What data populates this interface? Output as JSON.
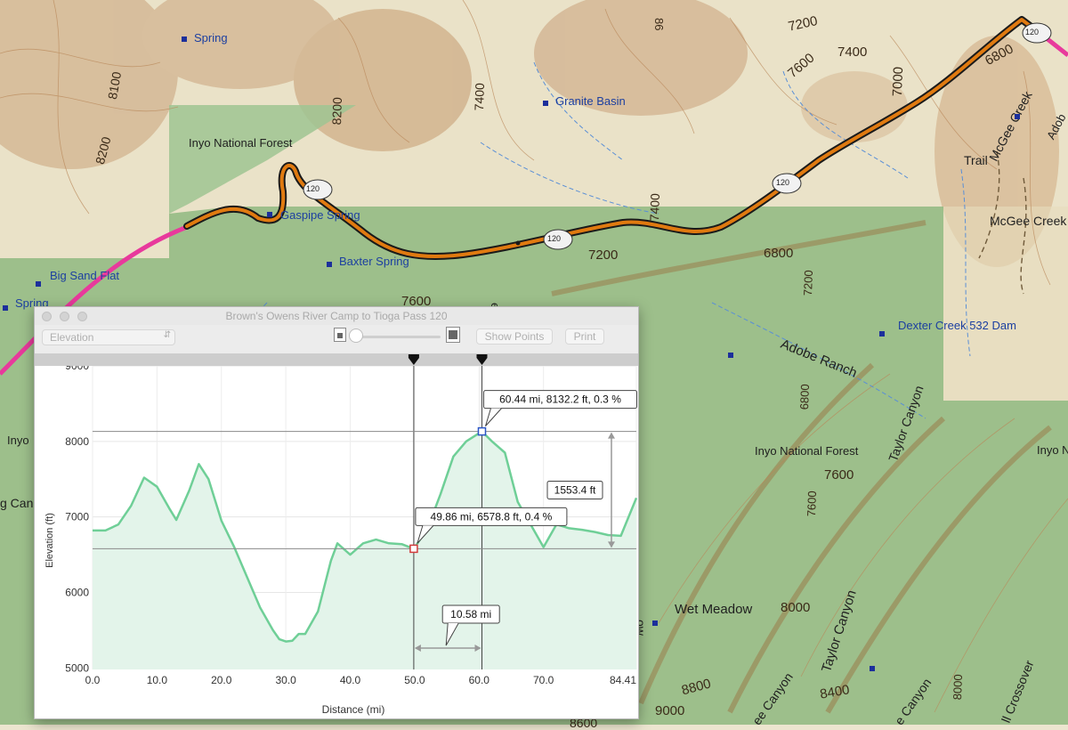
{
  "map": {
    "labels": {
      "spring_top": "Spring",
      "granite_basin": "Granite Basin",
      "inyo_nf_top": "Inyo National Forest",
      "gaspipe_spring": "Gaspipe Spring",
      "baxter_spring": "Baxter Spring",
      "big_sand_flat": "Big Sand Flat",
      "spring_left": "Spring",
      "trail": "Trail",
      "mcgee_creek_diag": "McGee Creek",
      "mcgee_creek": "McGee Creek",
      "adobe_right": "Adob",
      "dexter_creek_dam": "Dexter Creek 532 Dam",
      "adobe_ranch": "Adobe Ranch",
      "taylor_canyon": "Taylor Canyon",
      "inyo_nf_bottom": "Inyo National Forest",
      "inyo_right": "Inyo N",
      "inyo_left": "Inyo",
      "wet_meadow": "Wet Meadow",
      "taylor_canyon_2": "Taylor Canyon",
      "canyon_1": "ee Canyon",
      "canyon_2": "e Canyon",
      "crossover": "ll Crossover",
      "g_can": "g Can",
      "route_120_a": "120",
      "route_120_b": "120",
      "route_120_c": "120",
      "route_120_d": "120",
      "ers": "ers",
      "ow": "ow"
    },
    "elev": {
      "e8100": "8100",
      "e8200_left": "8200",
      "e8200": "8200",
      "e7400_top": "7400",
      "e7200_top": "7200",
      "e7600_top": "7600",
      "e7400_r": "7400",
      "e7000": "7000",
      "e6800_top": "6800",
      "e86": "86",
      "e7400_mid": "7400",
      "e7200_mid": "7200",
      "e6800_mid": "6800",
      "e7200_v": "7200",
      "e7600_left": "7600",
      "e6800_v": "6800",
      "e7600_r": "7600",
      "e7600_v": "7600",
      "e8000": "8000",
      "e8800": "8800",
      "e8400": "8400",
      "e9000": "9000",
      "e8000_v": "8000",
      "e8600": "8600"
    },
    "colors": {
      "route": "#e07a10",
      "route_outline": "#1a1a1a",
      "connector": "#e8399c",
      "forest": "#8fb880",
      "terrain": "#e8dfc3"
    }
  },
  "window": {
    "title": "Brown's Owens River Camp to Tioga Pass 120",
    "profile_select": "Elevation",
    "show_points_label": "Show Points",
    "print_label": "Print"
  },
  "chart_data": {
    "type": "area",
    "xlabel": "Distance (mi)",
    "ylabel": "Elevation (ft)",
    "x_ticks": [
      "0.0",
      "10.0",
      "20.0",
      "30.0",
      "40.0",
      "50.0",
      "60.0",
      "70.0",
      "84.41"
    ],
    "y_ticks": [
      "9000",
      "8000",
      "7000",
      "6000",
      "5000"
    ],
    "xlim": [
      0,
      84.41
    ],
    "ylim": [
      4980,
      9000
    ],
    "grid": true,
    "x": [
      0,
      2,
      4,
      6,
      8,
      10,
      12,
      13,
      15,
      16.5,
      18,
      20,
      22,
      24,
      26,
      28,
      29,
      30,
      31,
      32,
      33,
      35,
      37,
      38,
      40,
      42,
      44,
      46,
      48,
      49.86,
      52,
      54,
      56,
      58,
      60.44,
      62,
      64,
      66,
      68,
      70,
      72,
      74,
      76,
      78,
      80,
      82,
      84.41
    ],
    "values": [
      6820,
      6820,
      6900,
      7150,
      7520,
      7400,
      7100,
      6960,
      7350,
      7700,
      7500,
      6950,
      6600,
      6200,
      5800,
      5500,
      5380,
      5350,
      5360,
      5450,
      5450,
      5750,
      6420,
      6650,
      6500,
      6650,
      6700,
      6650,
      6640,
      6578.8,
      6850,
      7300,
      7800,
      8000,
      8132.2,
      8000,
      7850,
      7200,
      6900,
      6600,
      6900,
      6850,
      6830,
      6800,
      6760,
      6750,
      7250
    ],
    "markers": [
      {
        "x": 49.86,
        "y": 6578.8,
        "label": "49.86 mi, 6578.8 ft, 0.4 %"
      },
      {
        "x": 60.44,
        "y": 8132.2,
        "label": "60.44 mi, 8132.2 ft, 0.3 %"
      }
    ],
    "distance_label": "10.58 mi",
    "elevation_diff_label": "1553.4 ft",
    "colors": {
      "line": "#6fcf97",
      "fill": "#e3f4ea",
      "marker_low": "#d23c3c",
      "marker_high": "#2b56c7"
    }
  }
}
